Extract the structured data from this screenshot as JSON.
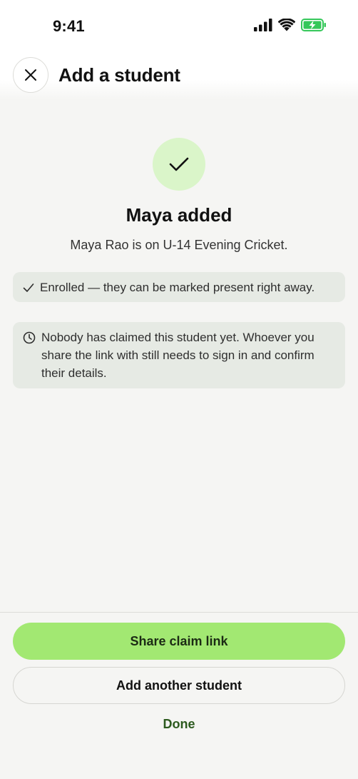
{
  "status_bar": {
    "time": "9:41",
    "icons": [
      "signal-icon",
      "wifi-icon",
      "battery-charging-icon"
    ]
  },
  "header": {
    "close_icon": "close-icon",
    "title": "Add a student"
  },
  "success": {
    "icon": "checkmark-icon",
    "headline": "Maya added",
    "subline": "Maya Rao is on U-14 Evening Cricket."
  },
  "notices": {
    "enrolled": {
      "icon": "check-icon",
      "text": "Enrolled — they can be marked present right away."
    },
    "unclaimed": {
      "icon": "clock-icon",
      "text": "Nobody has claimed this student yet. Whoever you share the link with still needs to sign in and confirm their details."
    }
  },
  "actions": {
    "share_label": "Share claim link",
    "add_another_label": "Add another student",
    "done_label": "Done"
  },
  "colors": {
    "accent": "#a2e872",
    "success_bg": "#daf5c9",
    "notice_bg": "#e6eae4",
    "link": "#2c5a1e",
    "battery": "#34c759"
  }
}
